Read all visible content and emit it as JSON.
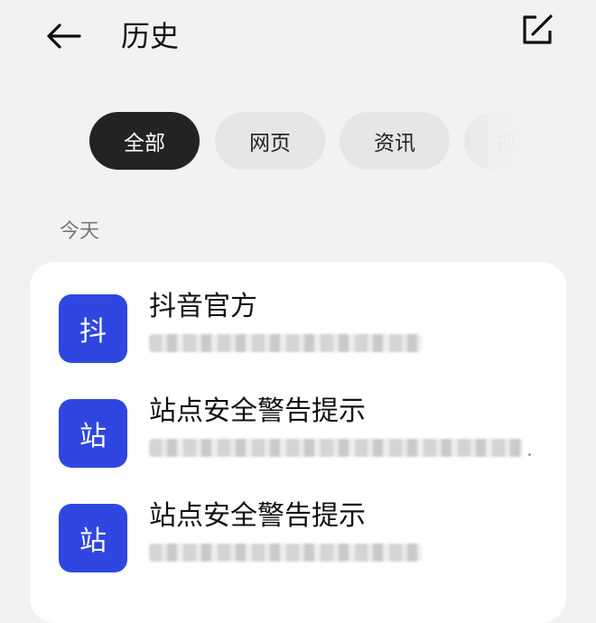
{
  "header": {
    "title": "历史",
    "back_icon": "arrow-left-icon",
    "edit_icon": "edit-square-icon"
  },
  "tabs": [
    {
      "label": "全部",
      "active": true
    },
    {
      "label": "网页",
      "active": false
    },
    {
      "label": "资讯",
      "active": false
    },
    {
      "label": "视",
      "active": false
    }
  ],
  "section": {
    "label": "今天"
  },
  "history": [
    {
      "favicon_char": "抖",
      "title": "抖音官方",
      "url": ""
    },
    {
      "favicon_char": "站",
      "title": "站点安全警告提示",
      "url": ""
    },
    {
      "favicon_char": "站",
      "title": "站点安全警告提示",
      "url": ""
    }
  ],
  "colors": {
    "background": "#f2f2f2",
    "active_tab": "#232323",
    "favicon_bg": "#2f47e0"
  }
}
